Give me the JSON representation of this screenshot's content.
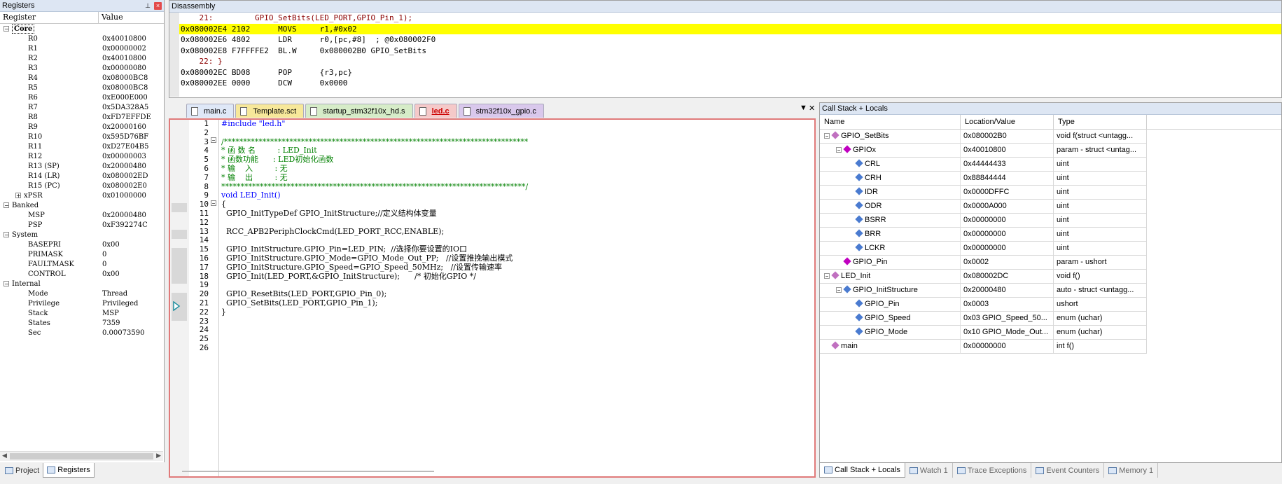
{
  "registers": {
    "title": "Registers",
    "col_register": "Register",
    "col_value": "Value",
    "rows": [
      {
        "name": "Core",
        "value": "",
        "level": 0,
        "toggle": "−",
        "group": true
      },
      {
        "name": "R0",
        "value": "0x40010800",
        "level": 1
      },
      {
        "name": "R1",
        "value": "0x00000002",
        "level": 1
      },
      {
        "name": "R2",
        "value": "0x40010800",
        "level": 1
      },
      {
        "name": "R3",
        "value": "0x00000080",
        "level": 1
      },
      {
        "name": "R4",
        "value": "0x08000BC8",
        "level": 1
      },
      {
        "name": "R5",
        "value": "0x08000BC8",
        "level": 1
      },
      {
        "name": "R6",
        "value": "0xE000E000",
        "level": 1
      },
      {
        "name": "R7",
        "value": "0x5DA328A5",
        "level": 1
      },
      {
        "name": "R8",
        "value": "0xFD7EFFDE",
        "level": 1
      },
      {
        "name": "R9",
        "value": "0x20000160",
        "level": 1
      },
      {
        "name": "R10",
        "value": "0x595D76BF",
        "level": 1
      },
      {
        "name": "R11",
        "value": "0xD27E04B5",
        "level": 1
      },
      {
        "name": "R12",
        "value": "0x00000003",
        "level": 1
      },
      {
        "name": "R13 (SP)",
        "value": "0x20000480",
        "level": 1
      },
      {
        "name": "R14 (LR)",
        "value": "0x080002ED",
        "level": 1
      },
      {
        "name": "R15 (PC)",
        "value": "0x080002E0",
        "level": 1
      },
      {
        "name": "xPSR",
        "value": "0x01000000",
        "level": 1,
        "toggle": "+"
      },
      {
        "name": "Banked",
        "value": "",
        "level": 0,
        "toggle": "−",
        "group": true
      },
      {
        "name": "MSP",
        "value": "0x20000480",
        "level": 1
      },
      {
        "name": "PSP",
        "value": "0xF392274C",
        "level": 1
      },
      {
        "name": "System",
        "value": "",
        "level": 0,
        "toggle": "−",
        "group": true
      },
      {
        "name": "BASEPRI",
        "value": "0x00",
        "level": 1
      },
      {
        "name": "PRIMASK",
        "value": "0",
        "level": 1
      },
      {
        "name": "FAULTMASK",
        "value": "0",
        "level": 1
      },
      {
        "name": "CONTROL",
        "value": "0x00",
        "level": 1
      },
      {
        "name": "Internal",
        "value": "",
        "level": 0,
        "toggle": "−",
        "group": true
      },
      {
        "name": "Mode",
        "value": "Thread",
        "level": 1
      },
      {
        "name": "Privilege",
        "value": "Privileged",
        "level": 1
      },
      {
        "name": "Stack",
        "value": "MSP",
        "level": 1
      },
      {
        "name": "States",
        "value": "7359",
        "level": 1
      },
      {
        "name": "Sec",
        "value": "0.00073590",
        "level": 1
      }
    ]
  },
  "left_tabs": [
    {
      "label": "Project",
      "active": false
    },
    {
      "label": "Registers",
      "active": true
    }
  ],
  "disassembly": {
    "title": "Disassembly",
    "lines": [
      {
        "text": "    21:         GPIO_SetBits(LED_PORT,GPIO_Pin_1);",
        "kind": "src"
      },
      {
        "text": "0x080002E4 2102      MOVS     r1,#0x02",
        "kind": "hl"
      },
      {
        "text": "0x080002E6 4802      LDR      r0,[pc,#8]  ; @0x080002F0",
        "kind": "asm"
      },
      {
        "text": "0x080002E8 F7FFFFE2  BL.W     0x080002B0 GPIO_SetBits",
        "kind": "asm"
      },
      {
        "text": "    22: }",
        "kind": "src"
      },
      {
        "text": "0x080002EC BD08      POP      {r3,pc}",
        "kind": "asm"
      },
      {
        "text": "0x080002EE 0000      DCW      0x0000",
        "kind": "asm"
      }
    ]
  },
  "editor_tabs": [
    {
      "label": "main.c",
      "color": "#dfe8f7",
      "active": false
    },
    {
      "label": "Template.sct",
      "color": "#f7e89a",
      "active": false
    },
    {
      "label": "startup_stm32f10x_hd.s",
      "color": "#d6ecc8",
      "active": false
    },
    {
      "label": "led.c",
      "color": "#f5c9c9",
      "active": true
    },
    {
      "label": "stm32f10x_gpio.c",
      "color": "#d9c8ec",
      "active": false
    }
  ],
  "editor_controls": {
    "dropdown": "▼",
    "close": "✕"
  },
  "code_lines": [
    "#include \"led.h\"",
    "",
    "/*******************************************************************************",
    "* 函 数 名         : LED_Init",
    "* 函数功能      : LED初始化函数",
    "* 输    入         : 无",
    "* 输    出         : 无",
    "*******************************************************************************/",
    "void LED_Init()",
    "{",
    "  GPIO_InitTypeDef GPIO_InitStructure;//定义结构体变量",
    "",
    "  RCC_APB2PeriphClockCmd(LED_PORT_RCC,ENABLE);",
    "",
    "  GPIO_InitStructure.GPIO_Pin=LED_PIN;  //选择你要设置的IO口",
    "  GPIO_InitStructure.GPIO_Mode=GPIO_Mode_Out_PP;   //设置推挽输出模式",
    "  GPIO_InitStructure.GPIO_Speed=GPIO_Speed_50MHz;   //设置传输速率",
    "  GPIO_Init(LED_PORT,&GPIO_InitStructure);      /* 初始化GPIO */",
    "",
    "  GPIO_ResetBits(LED_PORT,GPIO_Pin_0);",
    "  GPIO_SetBits(LED_PORT,GPIO_Pin_1);",
    "}",
    "",
    "",
    "",
    ""
  ],
  "callstack": {
    "title": "Call Stack + Locals",
    "col_name": "Name",
    "col_location": "Location/Value",
    "col_type": "Type",
    "rows": [
      {
        "name": "GPIO_SetBits",
        "value": "0x080002B0",
        "type": "void f(struct <untagg...",
        "indent": 0,
        "icon": "fn",
        "toggle": "−"
      },
      {
        "name": "GPIOx",
        "value": "0x40010800",
        "type": "param - struct <untag...",
        "indent": 1,
        "icon": "par",
        "toggle": "−"
      },
      {
        "name": "CRL",
        "value": "0x44444433",
        "type": "uint",
        "indent": 2,
        "icon": "var"
      },
      {
        "name": "CRH",
        "value": "0x88844444",
        "type": "uint",
        "indent": 2,
        "icon": "var"
      },
      {
        "name": "IDR",
        "value": "0x0000DFFC",
        "type": "uint",
        "indent": 2,
        "icon": "var"
      },
      {
        "name": "ODR",
        "value": "0x0000A000",
        "type": "uint",
        "indent": 2,
        "icon": "var"
      },
      {
        "name": "BSRR",
        "value": "0x00000000",
        "type": "uint",
        "indent": 2,
        "icon": "var"
      },
      {
        "name": "BRR",
        "value": "0x00000000",
        "type": "uint",
        "indent": 2,
        "icon": "var"
      },
      {
        "name": "LCKR",
        "value": "0x00000000",
        "type": "uint",
        "indent": 2,
        "icon": "var"
      },
      {
        "name": "GPIO_Pin",
        "value": "0x0002",
        "type": "param - ushort",
        "indent": 1,
        "icon": "par"
      },
      {
        "name": "LED_Init",
        "value": "0x080002DC",
        "type": "void f()",
        "indent": 0,
        "icon": "fn",
        "toggle": "−"
      },
      {
        "name": "GPIO_InitStructure",
        "value": "0x20000480",
        "type": "auto - struct <untagg...",
        "indent": 1,
        "icon": "var",
        "toggle": "−"
      },
      {
        "name": "GPIO_Pin",
        "value": "0x0003",
        "type": "ushort",
        "indent": 2,
        "icon": "var"
      },
      {
        "name": "GPIO_Speed",
        "value": "0x03 GPIO_Speed_50...",
        "type": "enum (uchar)",
        "indent": 2,
        "icon": "var"
      },
      {
        "name": "GPIO_Mode",
        "value": "0x10 GPIO_Mode_Out...",
        "type": "enum (uchar)",
        "indent": 2,
        "icon": "var"
      },
      {
        "name": "main",
        "value": "0x00000000",
        "type": "int f()",
        "indent": 0,
        "icon": "fn"
      }
    ]
  },
  "bottom_tabs": [
    {
      "label": "Call Stack + Locals",
      "active": true
    },
    {
      "label": "Watch 1",
      "active": false
    },
    {
      "label": "Trace Exceptions",
      "active": false
    },
    {
      "label": "Event Counters",
      "active": false
    },
    {
      "label": "Memory 1",
      "active": false
    }
  ],
  "icons": {
    "pin": "pin-icon",
    "close": "close-icon"
  }
}
